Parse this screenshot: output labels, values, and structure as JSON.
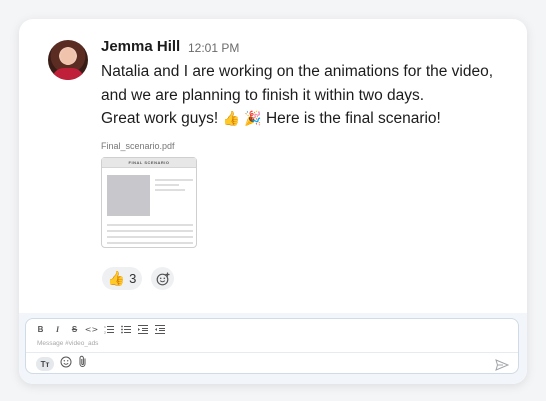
{
  "message": {
    "author": "Jemma Hill",
    "time": "12:01 PM",
    "line1": "Natalia and I are working on the animations for the video,",
    "line2": "and we are planning to finish it within two days.",
    "line3_text": "Great work guys!",
    "line3_emoji1": "👍",
    "line3_emoji2": "🎉",
    "line3_tail": "Here is the final scenario!",
    "attachment": {
      "filename": "Final_scenario.pdf",
      "heading": "FINAL SCENARIO"
    },
    "reactions": [
      {
        "emoji": "👍",
        "count": "3"
      }
    ]
  },
  "composer": {
    "placeholder": "Message #video_ads",
    "toolbar_icons": [
      "bold-icon",
      "italic-icon",
      "strikethrough-icon",
      "code-icon",
      "ordered-list-icon",
      "bullet-list-icon",
      "indent-icon",
      "outdent-icon"
    ],
    "bottom_icons": [
      "text-format-icon",
      "emoji-icon",
      "attachment-icon",
      "send-icon"
    ]
  },
  "colors": {
    "background": "#f4f5f7",
    "card": "#ffffff",
    "composer_bg": "#f2f6fa",
    "shirt": "#c01f3a"
  }
}
